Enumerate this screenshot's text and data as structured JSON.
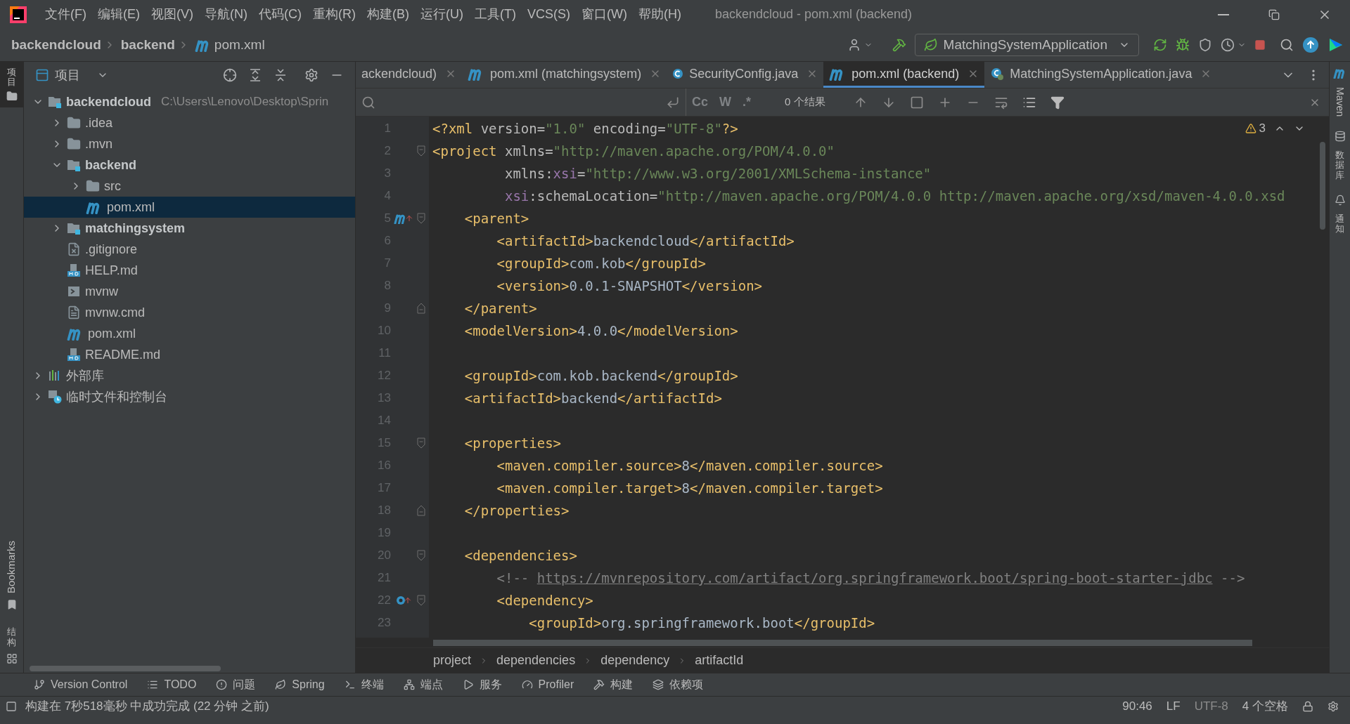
{
  "window": {
    "title": "backendcloud - pom.xml (backend)"
  },
  "menu": [
    "文件(F)",
    "编辑(E)",
    "视图(V)",
    "导航(N)",
    "代码(C)",
    "重构(R)",
    "构建(B)",
    "运行(U)",
    "工具(T)",
    "VCS(S)",
    "窗口(W)",
    "帮助(H)"
  ],
  "breadcrumb": [
    {
      "label": "backendcloud",
      "kind": "folder"
    },
    {
      "label": "backend",
      "kind": "folder"
    },
    {
      "label": "pom.xml",
      "kind": "maven"
    }
  ],
  "run_config": "MatchingSystemApplication",
  "left_strip": {
    "top": "项目",
    "bottom": [
      "Bookmarks",
      "结构"
    ]
  },
  "right_strip": [
    "Maven",
    "数据库",
    "通知"
  ],
  "project_panel": {
    "title": "项目",
    "tree": [
      {
        "label": "backendcloud",
        "hint": "C:\\Users\\Lenovo\\Desktop\\Sprin",
        "kind": "module",
        "expanded": true,
        "selected": false,
        "children": [
          {
            "label": ".idea",
            "kind": "folder",
            "expanded": false,
            "selected": false
          },
          {
            "label": ".mvn",
            "kind": "folder",
            "expanded": false,
            "selected": false
          },
          {
            "label": "backend",
            "kind": "module",
            "expanded": true,
            "selected": false,
            "children": [
              {
                "label": "src",
                "kind": "folder",
                "expanded": false,
                "selected": false
              },
              {
                "label": "pom.xml",
                "kind": "maven",
                "selected": true
              }
            ]
          },
          {
            "label": "matchingsystem",
            "kind": "module",
            "expanded": false,
            "selected": false
          },
          {
            "label": ".gitignore",
            "kind": "gitignore",
            "selected": false
          },
          {
            "label": "HELP.md",
            "kind": "md",
            "selected": false
          },
          {
            "label": "mvnw",
            "kind": "script",
            "selected": false
          },
          {
            "label": "mvnw.cmd",
            "kind": "text",
            "selected": false
          },
          {
            "label": "pom.xml",
            "kind": "maven",
            "selected": false
          },
          {
            "label": "README.md",
            "kind": "md",
            "selected": false
          }
        ]
      },
      {
        "label": "外部库",
        "kind": "library",
        "expanded": false,
        "selected": false
      },
      {
        "label": "临时文件和控制台",
        "kind": "scratch",
        "expanded": false,
        "selected": false
      }
    ]
  },
  "tabs": [
    {
      "label": "ackendcloud)",
      "selected": false
    },
    {
      "label": "pom.xml (matchingsystem)",
      "kind": "maven",
      "selected": false
    },
    {
      "label": "SecurityConfig.java",
      "kind": "class",
      "selected": false
    },
    {
      "label": "pom.xml (backend)",
      "kind": "maven",
      "selected": true
    },
    {
      "label": "MatchingSystemApplication.java",
      "kind": "app",
      "selected": false
    }
  ],
  "search_bar": {
    "toggles": [
      "Cc",
      "W",
      ".*"
    ],
    "results": "0 个结果"
  },
  "warnings": "3",
  "code": [
    {
      "number": "1",
      "tokens": [
        {
          "kind": "t",
          "text": "<?xml "
        },
        {
          "kind": "a",
          "text": "version="
        },
        {
          "kind": "v",
          "text": "\"1.0\""
        },
        {
          "kind": "a",
          "text": " encoding="
        },
        {
          "kind": "v",
          "text": "\"UTF-8\""
        },
        {
          "kind": "t",
          "text": "?>"
        }
      ]
    },
    {
      "number": "2",
      "fold_open": true,
      "tokens": [
        {
          "kind": "t",
          "text": "<project"
        },
        {
          "kind": "a",
          "text": " xmlns="
        },
        {
          "kind": "v",
          "text": "\"http://maven.apache.org/POM/4.0.0\""
        }
      ]
    },
    {
      "number": "3",
      "tokens": [
        {
          "kind": "a",
          "text": "         xmlns:"
        },
        {
          "kind": "n",
          "text": "xsi"
        },
        {
          "kind": "a",
          "text": "="
        },
        {
          "kind": "v",
          "text": "\"http://www.w3.org/2001/XMLSchema-instance\""
        }
      ]
    },
    {
      "number": "4",
      "tokens": [
        {
          "kind": "n",
          "text": "         xsi"
        },
        {
          "kind": "a",
          "text": ":schemaLocation="
        },
        {
          "kind": "v",
          "text": "\"http://maven.apache.org/POM/4.0.0 http://maven.apache.org/xsd/maven-4.0.0.xsd"
        }
      ]
    },
    {
      "number": "5",
      "fold_open": true,
      "maven_marker": true,
      "tokens": [
        {
          "kind": "t",
          "text": "    <parent>"
        }
      ]
    },
    {
      "number": "6",
      "tokens": [
        {
          "kind": "t",
          "text": "        <artifactId>"
        },
        {
          "kind": "x",
          "text": "backendcloud"
        },
        {
          "kind": "t",
          "text": "</artifactId>"
        }
      ]
    },
    {
      "number": "7",
      "tokens": [
        {
          "kind": "t",
          "text": "        <groupId>"
        },
        {
          "kind": "x",
          "text": "com.kob"
        },
        {
          "kind": "t",
          "text": "</groupId>"
        }
      ]
    },
    {
      "number": "8",
      "tokens": [
        {
          "kind": "t",
          "text": "        <version>"
        },
        {
          "kind": "x",
          "text": "0.0.1-SNAPSHOT"
        },
        {
          "kind": "t",
          "text": "</version>"
        }
      ]
    },
    {
      "number": "9",
      "fold_close": true,
      "tokens": [
        {
          "kind": "t",
          "text": "    </parent>"
        }
      ]
    },
    {
      "number": "10",
      "tokens": [
        {
          "kind": "t",
          "text": "    <modelVersion>"
        },
        {
          "kind": "x",
          "text": "4.0.0"
        },
        {
          "kind": "t",
          "text": "</modelVersion>"
        }
      ]
    },
    {
      "number": "11"
    },
    {
      "number": "12",
      "tokens": [
        {
          "kind": "t",
          "text": "    <groupId>"
        },
        {
          "kind": "x",
          "text": "com.kob.backend"
        },
        {
          "kind": "t",
          "text": "</groupId>"
        }
      ]
    },
    {
      "number": "13",
      "tokens": [
        {
          "kind": "t",
          "text": "    <artifactId>"
        },
        {
          "kind": "x",
          "text": "backend"
        },
        {
          "kind": "t",
          "text": "</artifactId>"
        }
      ]
    },
    {
      "number": "14"
    },
    {
      "number": "15",
      "fold_open": true,
      "tokens": [
        {
          "kind": "t",
          "text": "    <properties>"
        }
      ]
    },
    {
      "number": "16",
      "tokens": [
        {
          "kind": "t",
          "text": "        <maven.compiler.source>"
        },
        {
          "kind": "x",
          "text": "8"
        },
        {
          "kind": "t",
          "text": "</maven.compiler.source>"
        }
      ]
    },
    {
      "number": "17",
      "tokens": [
        {
          "kind": "t",
          "text": "        <maven.compiler.target>"
        },
        {
          "kind": "x",
          "text": "8"
        },
        {
          "kind": "t",
          "text": "</maven.compiler.target>"
        }
      ]
    },
    {
      "number": "18",
      "fold_close": true,
      "tokens": [
        {
          "kind": "t",
          "text": "    </properties>"
        }
      ]
    },
    {
      "number": "19"
    },
    {
      "number": "20",
      "fold_open": true,
      "tokens": [
        {
          "kind": "t",
          "text": "    <dependencies>"
        }
      ]
    },
    {
      "number": "21",
      "tokens": [
        {
          "kind": "c",
          "text": "        <!-- "
        },
        {
          "kind": "u",
          "text": "https://mvnrepository.com/artifact/org.springframework.boot/spring-boot-starter-jdbc"
        },
        {
          "kind": "c",
          "text": " -->"
        }
      ]
    },
    {
      "number": "22",
      "fold_open": true,
      "dependency_marker": true,
      "tokens": [
        {
          "kind": "t",
          "text": "        <dependency>"
        }
      ]
    },
    {
      "number": "23",
      "tokens": [
        {
          "kind": "t",
          "text": "            <groupId>"
        },
        {
          "kind": "x",
          "text": "org.springframework.boot"
        },
        {
          "kind": "t",
          "text": "</groupId>"
        }
      ]
    }
  ],
  "editor_breadcrumb": [
    "project",
    "dependencies",
    "dependency",
    "artifactId"
  ],
  "tool_windows": [
    {
      "label": "Version Control",
      "kind": "vcs"
    },
    {
      "label": "TODO",
      "kind": "todo"
    },
    {
      "label": "问题",
      "kind": "problems"
    },
    {
      "label": "Spring",
      "kind": "spring"
    },
    {
      "label": "终端",
      "kind": "terminal"
    },
    {
      "label": "端点",
      "kind": "endpoints"
    },
    {
      "label": "服务",
      "kind": "services"
    },
    {
      "label": "Profiler",
      "kind": "profiler"
    },
    {
      "label": "构建",
      "kind": "build"
    },
    {
      "label": "依赖项",
      "kind": "deps"
    }
  ],
  "status_bar": {
    "message": "构建在 7秒518毫秒 中成功完成 (22 分钟 之前)",
    "position": "90:46",
    "line_ending": "LF",
    "encoding": "UTF-8",
    "indent": "4 个空格"
  }
}
